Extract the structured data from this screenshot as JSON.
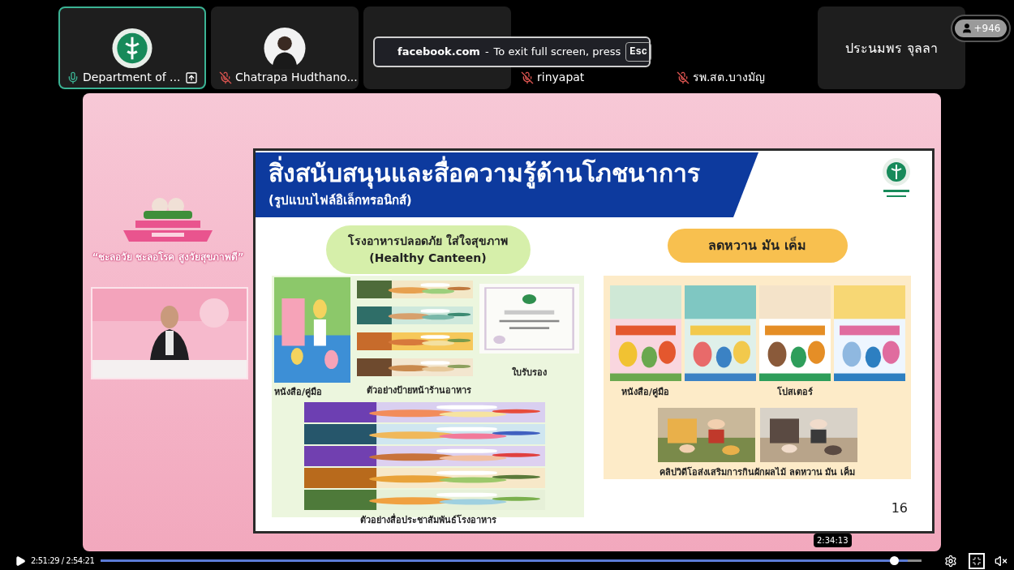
{
  "participants": [
    {
      "kind": "emblem_tile",
      "name": "Department of ...",
      "muted": false,
      "speaking": true,
      "sharing": true
    },
    {
      "kind": "person_tile",
      "name": "Chatrapa Hudthano...",
      "muted": true,
      "speaking": false,
      "sharing": false
    },
    {
      "kind": "blank"
    },
    {
      "kind": "label",
      "name": "rinyapat",
      "muted": true
    },
    {
      "kind": "label",
      "name": "รพ.สต.บางมัญ",
      "muted": true
    },
    {
      "kind": "name_tile",
      "name": "ประนมพร จุลลา"
    }
  ],
  "overflow_badge": "+946",
  "fullscreen_notice": {
    "site": "facebook.com",
    "separator": "-",
    "message": "To exit full screen, press",
    "key": "Esc"
  },
  "stage": {
    "tagline": "“ชะลอวัย ชะลอโรค สูงวัยสุขภาพดี”"
  },
  "slide": {
    "title": "สิ่งสนับสนุนและสื่อความรู้ด้านโภชนาการ",
    "subtitle": "(รูปแบบไฟล์อิเล็กทรอนิกส์)",
    "page": "16",
    "canteen": {
      "heading": [
        "โรงอาหารปลอดภัย ใส่ใจสุขภาพ",
        "(Healthy Canteen)"
      ],
      "book_caption": "หนังสือ/คู่มือ",
      "signs_caption": "ตัวอย่างป้ายหน้าร้านอาหาร",
      "certificate_caption": "ใบรับรอง",
      "promo_caption": "ตัวอย่างสื่อประชาสัมพันธ์โรงอาหาร"
    },
    "reduce": {
      "heading": "ลดหวาน มัน เค็ม",
      "book_caption": "หนังสือ/คู่มือ",
      "poster_caption": "โปสเตอร์",
      "video_caption": "คลิปวิดีโอส่งเสริมการกินผักผลไม้ ลดหวาน มัน เค็ม"
    }
  },
  "player": {
    "playing": false,
    "time": "2:51:29 / 2:54:21",
    "level": 0.983,
    "hover_time": "2:34:13",
    "muted": true
  }
}
